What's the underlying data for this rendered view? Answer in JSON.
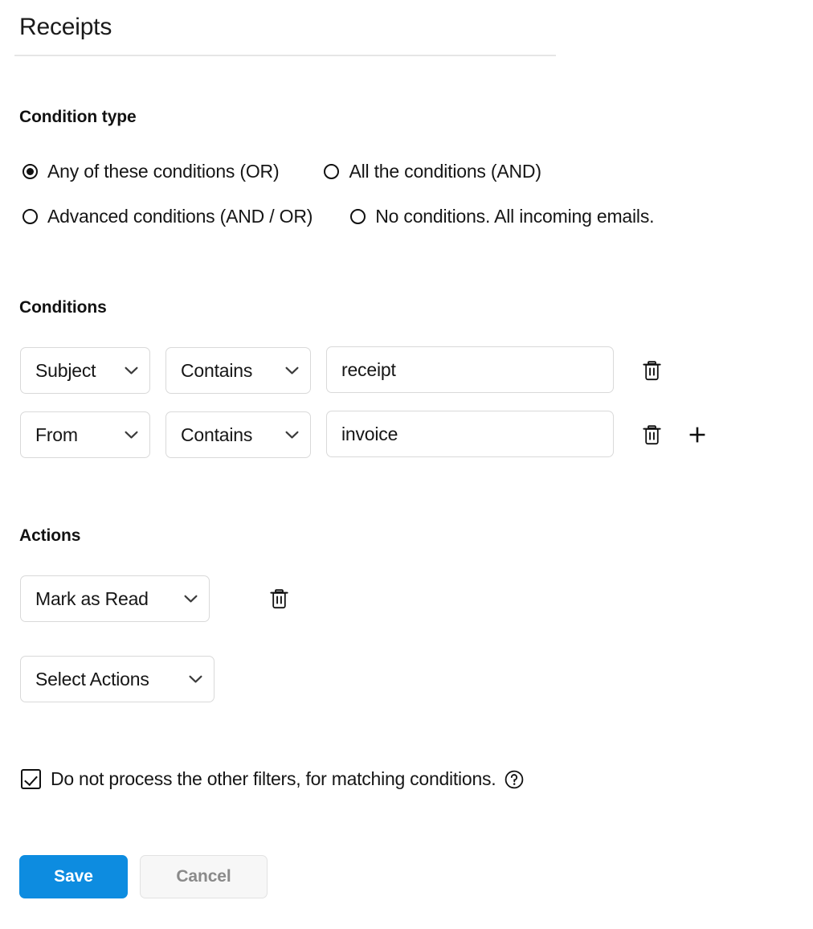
{
  "page": {
    "title": "Receipts"
  },
  "condition_type": {
    "heading": "Condition type",
    "options": [
      {
        "label": "Any of these conditions (OR)",
        "selected": true
      },
      {
        "label": "All the conditions (AND)",
        "selected": false
      },
      {
        "label": "Advanced conditions (AND / OR)",
        "selected": false
      },
      {
        "label": "No conditions. All incoming emails.",
        "selected": false
      }
    ]
  },
  "conditions": {
    "heading": "Conditions",
    "rows": [
      {
        "field": "Subject",
        "operator": "Contains",
        "value": "receipt",
        "delete_icon": "trash-icon"
      },
      {
        "field": "From",
        "operator": "Contains",
        "value": "invoice",
        "delete_icon": "trash-icon"
      }
    ],
    "add_icon": "plus-icon"
  },
  "actions": {
    "heading": "Actions",
    "rows": [
      {
        "value": "Mark as Read",
        "delete_icon": "trash-icon"
      }
    ],
    "add_placeholder": "Select Actions"
  },
  "options_checkbox": {
    "label": "Do not process the other filters, for matching conditions.",
    "checked": true,
    "help_icon": "question-circle-icon"
  },
  "footer": {
    "save_label": "Save",
    "cancel_label": "Cancel"
  },
  "colors": {
    "accent": "#0d8ce0",
    "border": "#d9d9d9",
    "divider": "#e6e6e6",
    "cancel_text": "#8a8a8a",
    "cancel_bg": "#f7f7f7"
  }
}
